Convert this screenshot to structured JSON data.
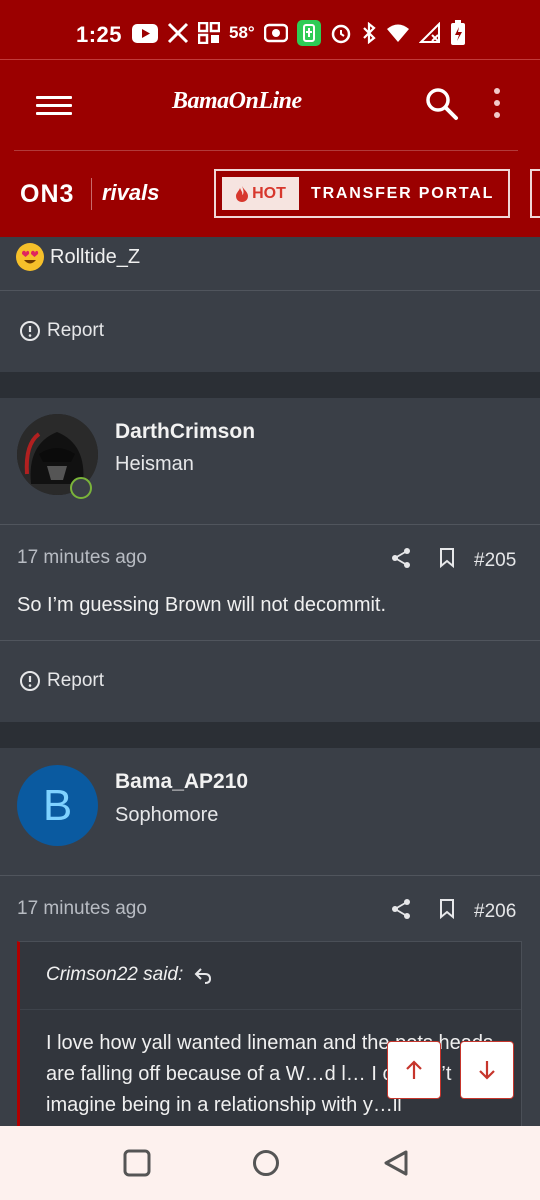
{
  "status_bar": {
    "time": "1:25",
    "temperature": "58°"
  },
  "header": {
    "logo": "BamaOnLine",
    "menu_icon": "hamburger-icon",
    "search_icon": "search-icon",
    "more_icon": "more-vertical-icon"
  },
  "partners": {
    "on3": "ON3",
    "rivals": "rivals",
    "hot_badge": "HOT",
    "portal_label": "TRANSFER PORTAL"
  },
  "colors": {
    "brand_red": "#9b0000",
    "background": "#353a42",
    "post_bg": "#3a3f47",
    "quote_accent": "#b00000"
  },
  "prev_post": {
    "username": "Rolltide_Z",
    "report_label": "Report"
  },
  "posts": [
    {
      "username": "DarthCrimson",
      "rank": "Heisman",
      "time": "17 minutes ago",
      "number": "#205",
      "body": "So I’m guessing Brown will not decommit.",
      "report_label": "Report"
    },
    {
      "username": "Bama_AP210",
      "avatar_letter": "B",
      "rank": "Sophomore",
      "time": "17 minutes ago",
      "number": "#206",
      "quote": {
        "author": "Crimson22 said:",
        "text": "I love how yall wanted lineman and the pets heads are falling off because of a W…d l… I couldn’t imagine being in a relationship with y…ll"
      }
    }
  ]
}
